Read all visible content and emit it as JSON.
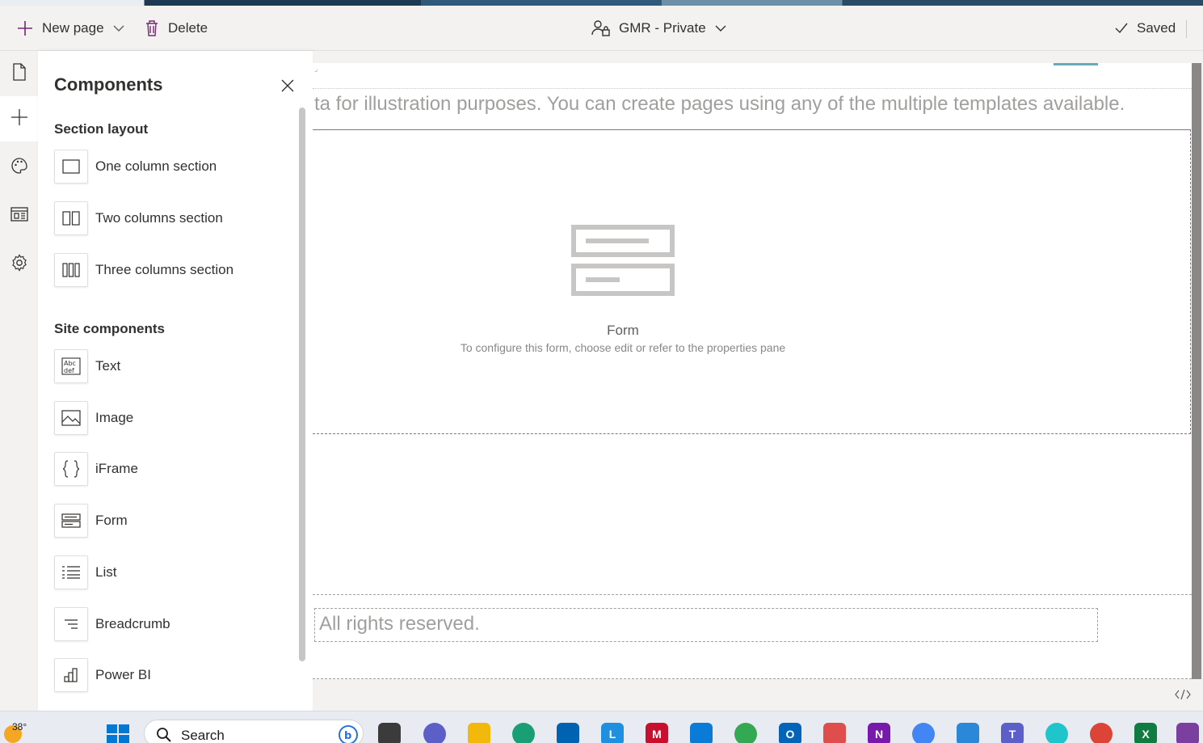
{
  "command_bar": {
    "new_page_label": "New page",
    "delete_label": "Delete",
    "environment_label": "GMR - Private",
    "saved_label": "Saved"
  },
  "rail": {
    "items": [
      "pages-icon",
      "add-icon",
      "themes-icon",
      "data-icon",
      "settings-icon"
    ]
  },
  "components_panel": {
    "title": "Components",
    "section_layout": {
      "heading": "Section layout",
      "items": [
        "One column section",
        "Two columns section",
        "Three columns section"
      ]
    },
    "site_components": {
      "heading": "Site components",
      "items": [
        "Text",
        "Image",
        "iFrame",
        "Form",
        "List",
        "Breadcrumb",
        "Power BI"
      ]
    }
  },
  "canvas": {
    "intro_text": "ta for illustration purposes. You can create pages using any of the multiple templates available.",
    "form_placeholder": {
      "title": "Form",
      "subtitle": "To configure this form, choose edit or refer to the properties pane"
    },
    "footer_text": "All rights reserved."
  },
  "taskbar": {
    "temperature": "38°",
    "search_label": "Search"
  },
  "colors": {
    "section_border": "#8a6b8f",
    "accent": "#6aa9b9",
    "panel_bg": "#ffffff",
    "chrome_bg": "#f3f2f1"
  }
}
